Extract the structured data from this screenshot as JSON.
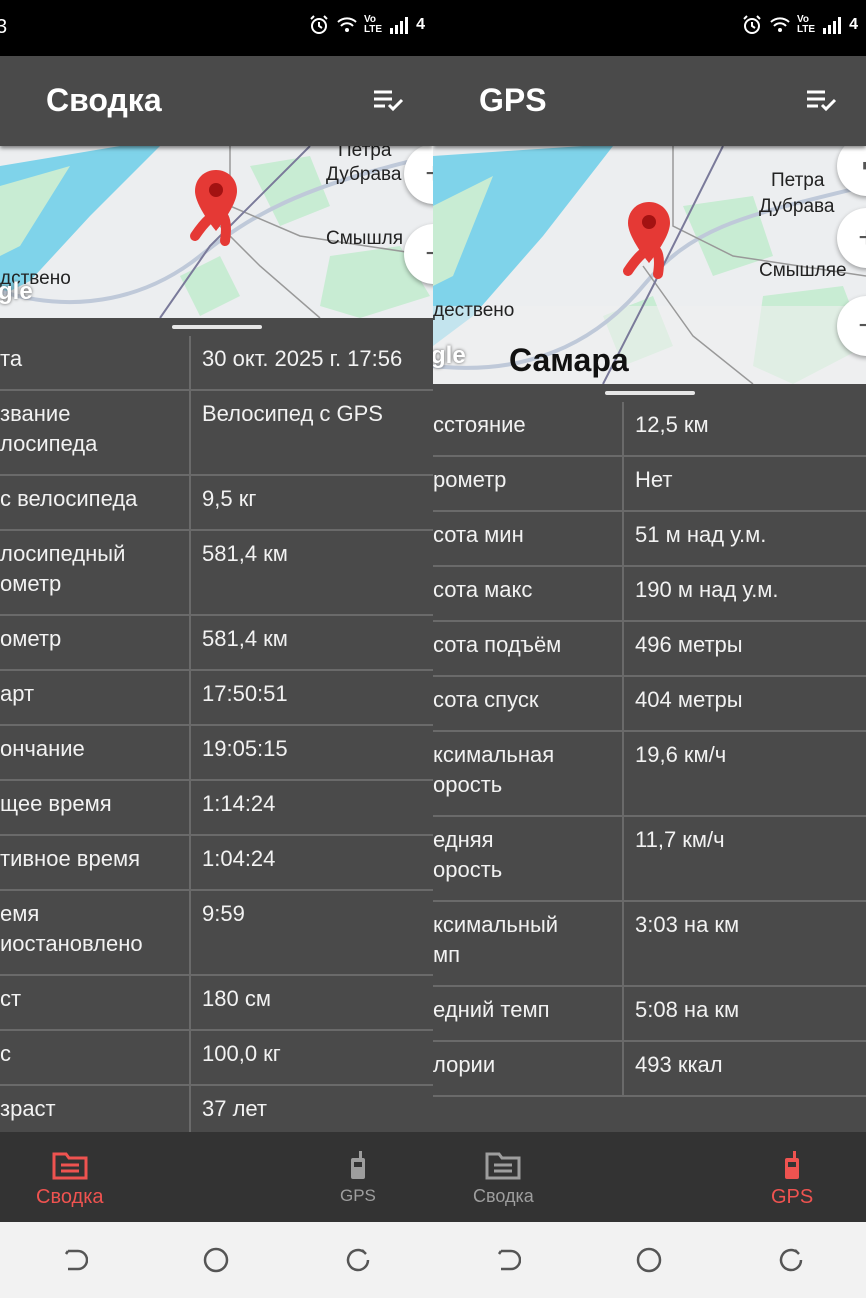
{
  "left": {
    "status": {
      "edge_text": "3",
      "right_text": "4",
      "volte_line1": "Vo",
      "volte_line2": "LTE"
    },
    "title": "Сводка",
    "map": {
      "labels": {
        "petra": "Петра",
        "dubrava": "Дубрава",
        "smyshl": "Смышля",
        "estv": "дствено",
        "google": "gle"
      }
    },
    "rows": [
      {
        "label": "та",
        "value": "30 окт. 2025 г. 17:56"
      },
      {
        "label": "звание\nлосипеда",
        "value": "Велосипед с GPS"
      },
      {
        "label": "с велосипеда",
        "value": "9,5 кг"
      },
      {
        "label": "лосипедный\nометр",
        "value": "581,4 км"
      },
      {
        "label": "ометр",
        "value": "581,4 км"
      },
      {
        "label": "арт",
        "value": "17:50:51"
      },
      {
        "label": "ончание",
        "value": "19:05:15"
      },
      {
        "label": "щее время",
        "value": "1:14:24"
      },
      {
        "label": "тивное время",
        "value": "1:04:24"
      },
      {
        "label": "емя\nиостановлено",
        "value": "9:59"
      },
      {
        "label": "ст",
        "value": "180 см"
      },
      {
        "label": "с",
        "value": "100,0 кг"
      },
      {
        "label": "зраст",
        "value": "37 лет"
      }
    ],
    "nav": {
      "summary": "Сводка",
      "gps": "GPS",
      "active": "summary"
    }
  },
  "right": {
    "status": {
      "right_text": "4",
      "volte_line1": "Vo",
      "volte_line2": "LTE"
    },
    "title": "GPS",
    "map": {
      "labels": {
        "petra": "Петра",
        "dubrava": "Дубрава",
        "smyshl": "Смышляе",
        "estv": "дествено",
        "google": "gle",
        "city": "Самара"
      }
    },
    "rows": [
      {
        "label": "сстояние",
        "value": "12,5 км"
      },
      {
        "label": "рометр",
        "value": "Нет"
      },
      {
        "label": "сота мин",
        "value": "51 м над у.м."
      },
      {
        "label": "сота макс",
        "value": "190 м над у.м."
      },
      {
        "label": "сота подъём",
        "value": "496 метры"
      },
      {
        "label": "сота спуск",
        "value": "404 метры"
      },
      {
        "label": "ксимальная\nорость",
        "value": "19,6 км/ч"
      },
      {
        "label": "едняя\nорость",
        "value": "11,7 км/ч"
      },
      {
        "label": "ксимальный\nмп",
        "value": "3:03 на км"
      },
      {
        "label": "едний темп",
        "value": "5:08 на км"
      },
      {
        "label": "лории",
        "value": "493 ккал"
      }
    ],
    "nav": {
      "summary": "Сводка",
      "gps": "GPS",
      "active": "gps"
    }
  },
  "colors": {
    "accent": "#ef5350",
    "nav_inactive": "#9e9e9e",
    "river": "#7fd3ea",
    "park": "#c8ecd3"
  }
}
